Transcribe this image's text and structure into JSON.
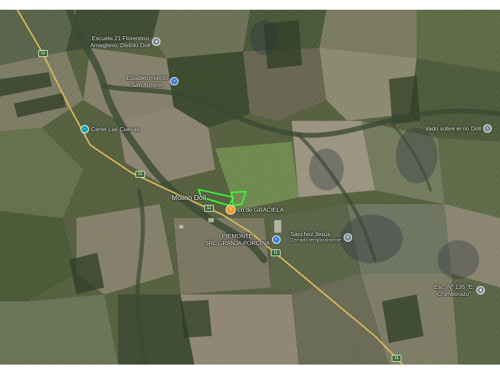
{
  "map": {
    "type": "satellite",
    "colors": {
      "field_dark": "#3c4a2e",
      "field_mid": "#5d6548",
      "field_light": "#8a8a6e",
      "field_tan": "#9a8f78",
      "field_green": "#6f8a4f",
      "river": "#46523a",
      "road": "#d8b95a",
      "highlight": "#35ff35"
    },
    "place_label": "Molino Doll",
    "route_number": "11",
    "pois": [
      {
        "id": "escuela21",
        "name_lines": [
          "Escuela 21 Florentino",
          "Ameghino, Distrito Doll"
        ],
        "icon": "school-icon"
      },
      {
        "id": "establecimiento",
        "name_lines": [
          "Establecimiento",
          "San Antonio"
        ],
        "icon": "building-icon"
      },
      {
        "id": "cartel",
        "name_lines": [
          "Cartel Las Cuevas"
        ],
        "icon": "landmark-icon"
      },
      {
        "id": "vado",
        "name_lines": [
          "Vado sobre el rio Doll"
        ],
        "icon": "landmark-icon"
      },
      {
        "id": "graciela",
        "name_lines": [
          "Lo de GRACIELA"
        ],
        "icon": "food-icon"
      },
      {
        "id": "piemonte",
        "name_lines": [
          "PIEMONTE",
          "SRL GRANJA PORCINA"
        ],
        "icon": "building-icon"
      },
      {
        "id": "sanchez",
        "name_lines": [
          "Sánchez Jesús"
        ],
        "sub": "Cerrado temporalmente",
        "icon": "place-icon"
      },
      {
        "id": "esc135",
        "name_lines": [
          "Esc. Nº 135 \"E.",
          "Chimborazo\""
        ],
        "icon": "school-icon"
      }
    ]
  }
}
